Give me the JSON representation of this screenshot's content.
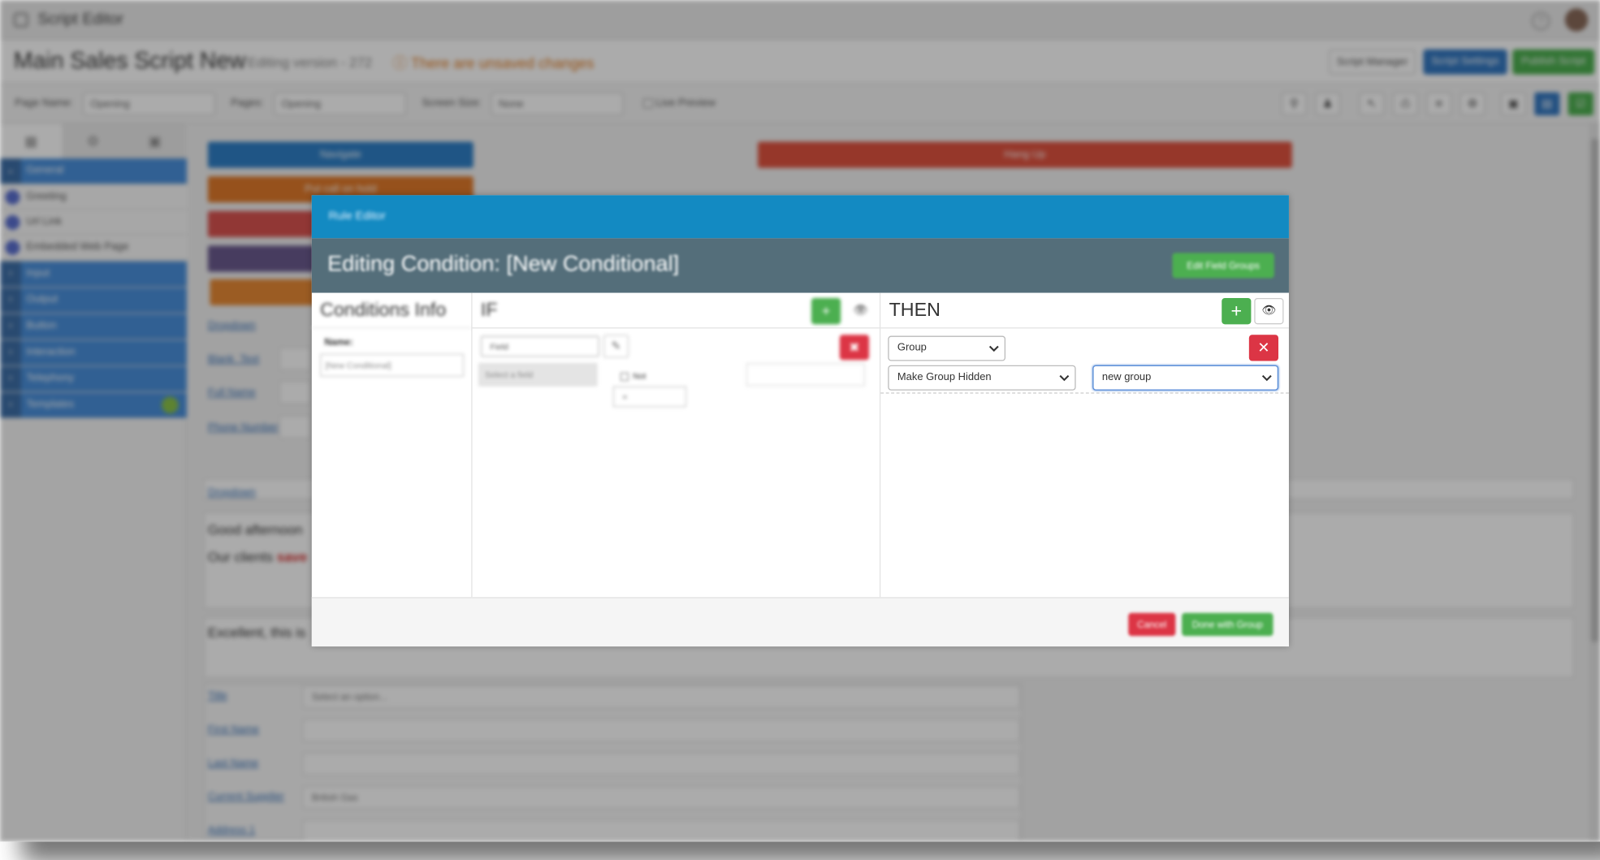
{
  "app": {
    "title": "Script Editor"
  },
  "header": {
    "script_name": "Main Sales Script New",
    "version": "Editing version - 272",
    "unsaved_warning": "There are unsaved changes",
    "buttons": {
      "script_manager": "Script Manager",
      "script_settings": "Script Settings",
      "publish": "Publish Script"
    }
  },
  "toolbar": {
    "page_name_label": "Page Name:",
    "page_name_value": "Opening",
    "pages_label": "Pages:",
    "pages_value": "Opening",
    "screen_size_label": "Screen Size:",
    "screen_size_value": "None",
    "live_preview_label": "Live Preview"
  },
  "sidebar": {
    "items": [
      {
        "label": "General",
        "kind": "group"
      },
      {
        "label": "Greeting",
        "kind": "element"
      },
      {
        "label": "Url Link",
        "kind": "element"
      },
      {
        "label": "Embedded Web Page",
        "kind": "element"
      },
      {
        "label": "Input",
        "kind": "group"
      },
      {
        "label": "Output",
        "kind": "group"
      },
      {
        "label": "Button",
        "kind": "group"
      },
      {
        "label": "Interaction",
        "kind": "group"
      },
      {
        "label": "Telephony",
        "kind": "group"
      },
      {
        "label": "Templates",
        "kind": "group"
      }
    ]
  },
  "canvas": {
    "buttons": {
      "navigate": "Navigate",
      "put_on_hold": "Put call on hold",
      "hang_up": "Hang Up"
    },
    "links": {
      "dropdown_1": "Dropdown",
      "blank_text": "Blank_Text",
      "full_name": "Full Name",
      "phone_number": "Phone Number",
      "dropdown_2": "Dropdown"
    },
    "texts": {
      "greeting": "Good afternoon",
      "clients": "Our clients",
      "clients_accent": "save",
      "excellent": "Excellent, this is"
    },
    "form": [
      {
        "label": "Title",
        "value": "Select an option..."
      },
      {
        "label": "First Name",
        "value": ""
      },
      {
        "label": "Last Name",
        "value": ""
      },
      {
        "label": "Current Supplier",
        "value": "British Gas"
      },
      {
        "label": "Address 1",
        "value": ""
      }
    ]
  },
  "modal": {
    "title": "Rule Editor",
    "subtitle": "Editing Condition: [New Conditional]",
    "edit_groups_button": "Edit Field Groups",
    "conditions_info": {
      "heading": "Conditions Info",
      "name_label": "Name:",
      "name_value": "[New Conditional]"
    },
    "if": {
      "heading": "IF",
      "type_value": "Field",
      "field_placeholder": "Select a field",
      "not_label": "Not",
      "operator_value": "="
    },
    "then": {
      "heading": "THEN",
      "type_value": "Group",
      "action_value": "Make Group Hidden",
      "target_value": "new group"
    },
    "footer": {
      "cancel": "Cancel",
      "save": "Done with Group"
    }
  },
  "colors": {
    "accent_blue": "#138ac2",
    "band": "#546e7a",
    "green": "#4caf50",
    "red": "#dc3545",
    "warning": "#e07a1f"
  }
}
